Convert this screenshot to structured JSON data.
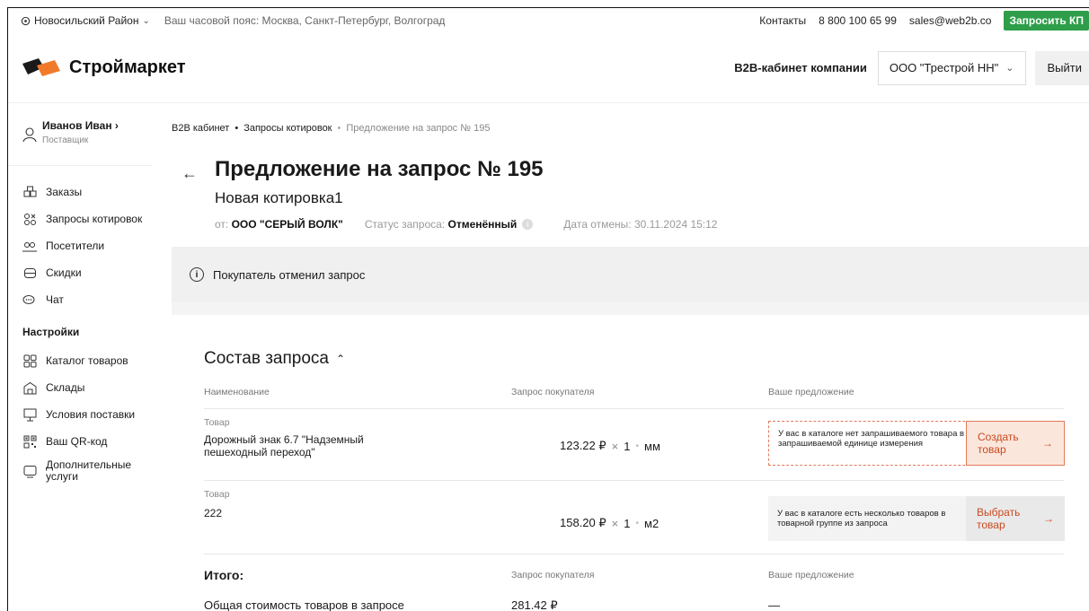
{
  "topbar": {
    "region": "Новосильский Район",
    "timezone": "Ваш часовой пояс: Москва, Санкт-Петербург, Волгоград",
    "contacts": "Контакты",
    "phone": "8 800 100 65 99",
    "email": "sales@web2b.co",
    "request_kp": "Запросить КП"
  },
  "header": {
    "logo_text": "Строймаркет",
    "b2b_label": "B2B-кабинет компании",
    "company": "ООО \"Трестрой НН\"",
    "logout": "Выйти"
  },
  "sidebar": {
    "user_name": "Иванов Иван ›",
    "user_role": "Поставщик",
    "items": [
      {
        "label": "Заказы",
        "icon": "orders-icon"
      },
      {
        "label": "Запросы котировок",
        "icon": "quotes-icon"
      },
      {
        "label": "Посетители",
        "icon": "visitors-icon"
      },
      {
        "label": "Скидки",
        "icon": "discounts-icon"
      },
      {
        "label": "Чат",
        "icon": "chat-icon"
      }
    ],
    "settings_title": "Настройки",
    "settings_items": [
      {
        "label": "Каталог товаров",
        "icon": "catalog-icon"
      },
      {
        "label": "Склады",
        "icon": "warehouse-icon"
      },
      {
        "label": "Условия поставки",
        "icon": "delivery-icon"
      },
      {
        "label": "Ваш QR-код",
        "icon": "qr-icon"
      },
      {
        "label": "Дополнительные услуги",
        "icon": "services-icon"
      }
    ]
  },
  "breadcrumb": {
    "b2b": "B2B кабинет",
    "quotes": "Запросы котировок",
    "current": "Предложение на запрос № 195"
  },
  "page": {
    "title": "Предложение на запрос № 195",
    "subtitle": "Новая котировка1",
    "from_label": "от:",
    "from_value": "ООО \"СЕРЫЙ ВОЛК\"",
    "status_label": "Статус запроса:",
    "status_value": "Отменённый",
    "cancel_date": "Дата отмены: 30.11.2024 15:12",
    "alert": "Покупатель отменил запрос"
  },
  "composition": {
    "title": "Состав запроса",
    "col_name": "Наименование",
    "col_request": "Запрос покупателя",
    "col_offer": "Ваше предложение",
    "rows": [
      {
        "type": "Товар",
        "name": "Дорожный знак 6.7 \"Надземный пешеходный переход\"",
        "price": "123.22 ₽",
        "qty": "1",
        "unit": "мм",
        "offer_text": "У вас в каталоге нет запрашиваемого товара в запрашиваемой единице измерения",
        "action": "Создать товар"
      },
      {
        "type": "Товар",
        "name": "222",
        "price": "158.20 ₽",
        "qty": "1",
        "unit": "м2",
        "offer_text": "У вас в каталоге есть несколько товаров в товарной группе из запроса",
        "action": "Выбрать товар"
      }
    ]
  },
  "totals": {
    "label": "Итого:",
    "col_request": "Запрос покупателя",
    "col_offer": "Ваше предложение",
    "row_label": "Общая стоимость товаров в запросе",
    "request_value": "281.42 ₽",
    "offer_value": "—"
  }
}
